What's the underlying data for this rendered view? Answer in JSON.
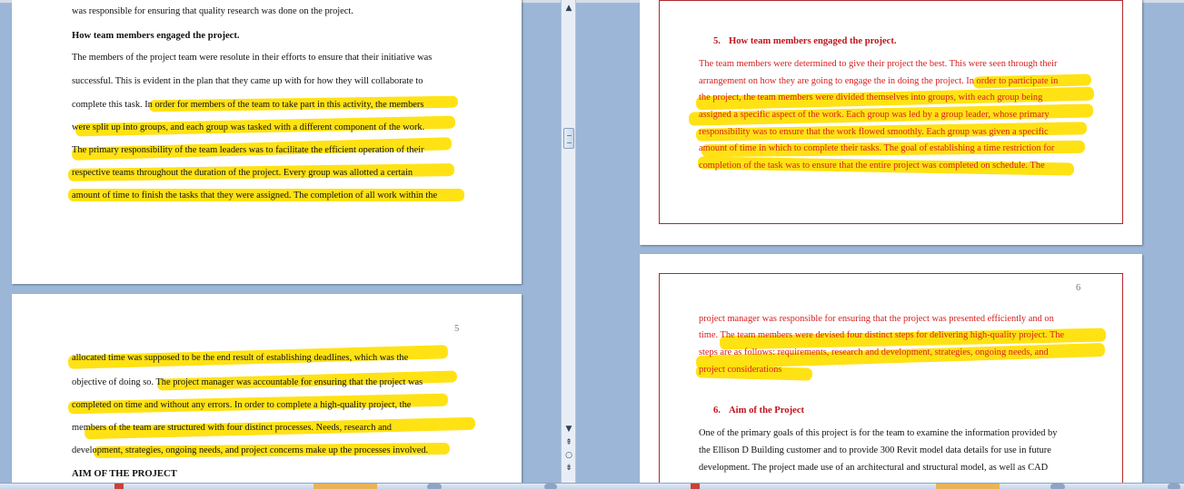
{
  "left_pages": {
    "page_top": {
      "lines": [
        "was responsible for ensuring that quality research was done on the project.",
        "How team members engaged the project.",
        "The members of the project team were resolute in their efforts to ensure that their initiative was",
        "successful. This is evident in the plan that they came up with for how they will collaborate to",
        "complete this task. In order for members of the team to take part in this activity, the members",
        "were split up into groups, and each group was tasked with a different component of the work.",
        "The primary responsibility of the team leaders was to facilitate the efficient operation of their",
        "respective teams throughout the duration of the project. Every group was allotted a certain",
        "amount of time to finish the tasks that they were assigned. The completion of all work within the"
      ]
    },
    "page_five": {
      "page_number": "5",
      "lines": [
        "allocated time was supposed to be the end result of establishing deadlines, which was the",
        "objective of doing so. The project manager was accountable for ensuring that the project was",
        "completed on time and without any errors. In order to complete a high-quality project, the",
        "members of the team are structured with four distinct processes. Needs, research and",
        "development, strategies, ongoing needs, and project concerns make up the processes involved.",
        "AIM OF THE PROJECT"
      ]
    }
  },
  "right_pages": {
    "page_top": {
      "heading_number": "5.",
      "heading": "How team members engaged the project.",
      "lines": [
        "The team members were determined to give their project the best. This were seen through their",
        "arrangement on how they are going to engage the in doing the project. In order to participate in",
        "the project, the team members were divided themselves into groups, with each group being",
        "assigned a specific aspect of the work. Each group was led by a group leader, whose primary",
        "responsibility was to ensure that the work flowed smoothly. Each group was given a specific",
        "amount of time in which to complete their tasks. The goal of establishing a time restriction for",
        "completion of the task was to ensure that the entire project was completed on schedule. The"
      ]
    },
    "page_six": {
      "page_number": "6",
      "lines": [
        "project manager was responsible for ensuring that the project was presented efficiently and on",
        "time. The team members were devised four distinct steps for delivering high-quality project. The",
        "steps are as follows: requirements, research and development, strategies, ongoing needs, and",
        "project considerations"
      ],
      "heading_number": "6.",
      "heading": "Aim of the Project",
      "body_lines": [
        "One of the primary goals of this project is for the team to examine the information provided by",
        "the Ellison D Building customer and to provide 300 Revit model data details for use in future",
        "development. The project made use of an architectural and structural model, as well as CAD"
      ]
    }
  },
  "colors": {
    "highlight": "#ffe000",
    "revision_text": "#d81e1e",
    "frame_border": "#b0282c",
    "workspace": "#9cb6d7"
  },
  "icons": {
    "scroll_up": "▲",
    "scroll_down": "▼",
    "prev_page": "⇞",
    "select_browse": "○",
    "next_page": "⇟"
  }
}
